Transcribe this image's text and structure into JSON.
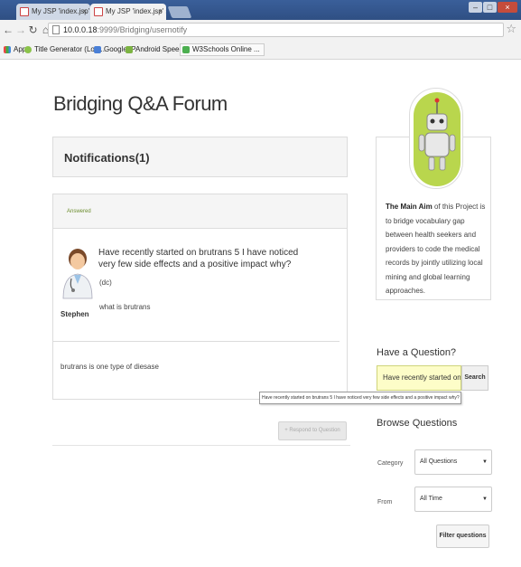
{
  "browser": {
    "tabs": [
      {
        "label": "My JSP 'index.jsp' startin"
      },
      {
        "label": "My JSP 'index.jsp' startin"
      }
    ],
    "url_host": "10.0.0.18",
    "url_path": ":9999/Bridging/usernotify",
    "bookmarks": [
      {
        "label": "Apps"
      },
      {
        "label": "Title Generator (Log..."
      },
      {
        "label": "Google IP"
      },
      {
        "label": "Android Speech to ..."
      },
      {
        "label": "W3Schools Online ..."
      }
    ]
  },
  "page": {
    "site_title": "Bridging Q&A Forum",
    "notifications_title": "Notifications(1)",
    "answer_card": {
      "status_label": "Answered",
      "asker_name": "Stephen",
      "question_title": "Have recently started on brutrans 5 I have noticed very few side effects and a positive impact why?",
      "question_tag": "(dc)",
      "question_body": "what is brutrans",
      "answer_text": "brutrans is one type of diesase"
    },
    "respond_button": "+ Respond to Question"
  },
  "sidebar": {
    "about_strong": "The Main Aim",
    "about_text": " of this Project is to bridge vocabulary gap between health seekers and providers to code the medical records by jointly utilizing local mining and global learning approaches.",
    "ask_heading": "Have a Question?",
    "search_value": "Have recently started on brutra",
    "search_button": "Search",
    "tooltip": "Have recently started on brutrans 5 I have noticed very few side effects and a positive impact why?",
    "browse_heading": "Browse Questions",
    "category_label": "Category",
    "category_value": "All Questions",
    "from_label": "From",
    "from_value": "All Time",
    "filter_button": "Filter questions"
  },
  "colors": {
    "logo_green": "#b9d64d",
    "answered_green": "#6b8d2e",
    "input_highlight": "#fdfdc8"
  }
}
